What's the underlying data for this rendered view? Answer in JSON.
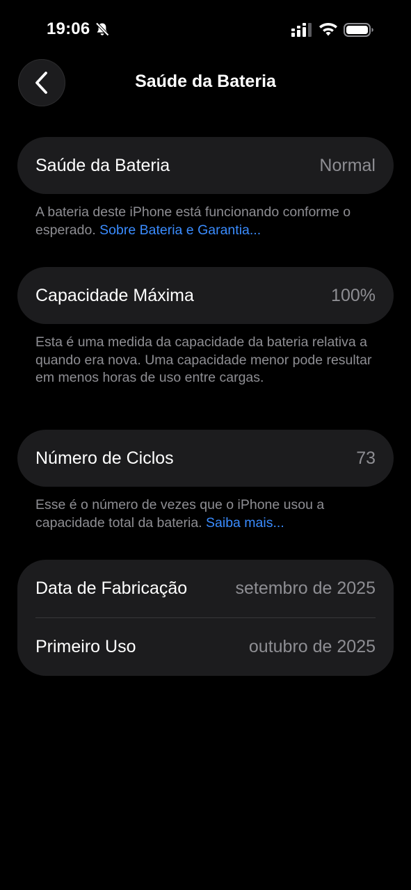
{
  "status_bar": {
    "time": "19:06"
  },
  "header": {
    "title": "Saúde da Bateria"
  },
  "battery_health": {
    "label": "Saúde da Bateria",
    "value": "Normal",
    "footnote_text": "A bateria deste iPhone está funcionando conforme o esperado.",
    "footnote_link": "Sobre Bateria e Garantia..."
  },
  "max_capacity": {
    "label": "Capacidade Máxima",
    "value": "100%",
    "footnote_text": "Esta é uma medida da capacidade da bateria relativa a quando era nova. Uma capacidade menor pode resultar em menos horas de uso entre cargas."
  },
  "cycle_count": {
    "label": "Número de Ciclos",
    "value": "73",
    "footnote_text": "Esse é o número de vezes que o iPhone usou a capacidade total da bateria.",
    "footnote_link": "Saiba mais..."
  },
  "dates": {
    "manufacture_label": "Data de Fabricação",
    "manufacture_value": "setembro de 2025",
    "first_use_label": "Primeiro Uso",
    "first_use_value": "outubro de 2025"
  },
  "colors": {
    "background": "#000000",
    "card": "#1c1c1e",
    "secondary_text": "#8e8e93",
    "link": "#3a8cff"
  },
  "icons": {
    "back": "chevron-left-icon",
    "silent": "bell-slash-icon",
    "signal": "cellular-signal-icon",
    "wifi": "wifi-icon",
    "battery": "battery-icon"
  }
}
